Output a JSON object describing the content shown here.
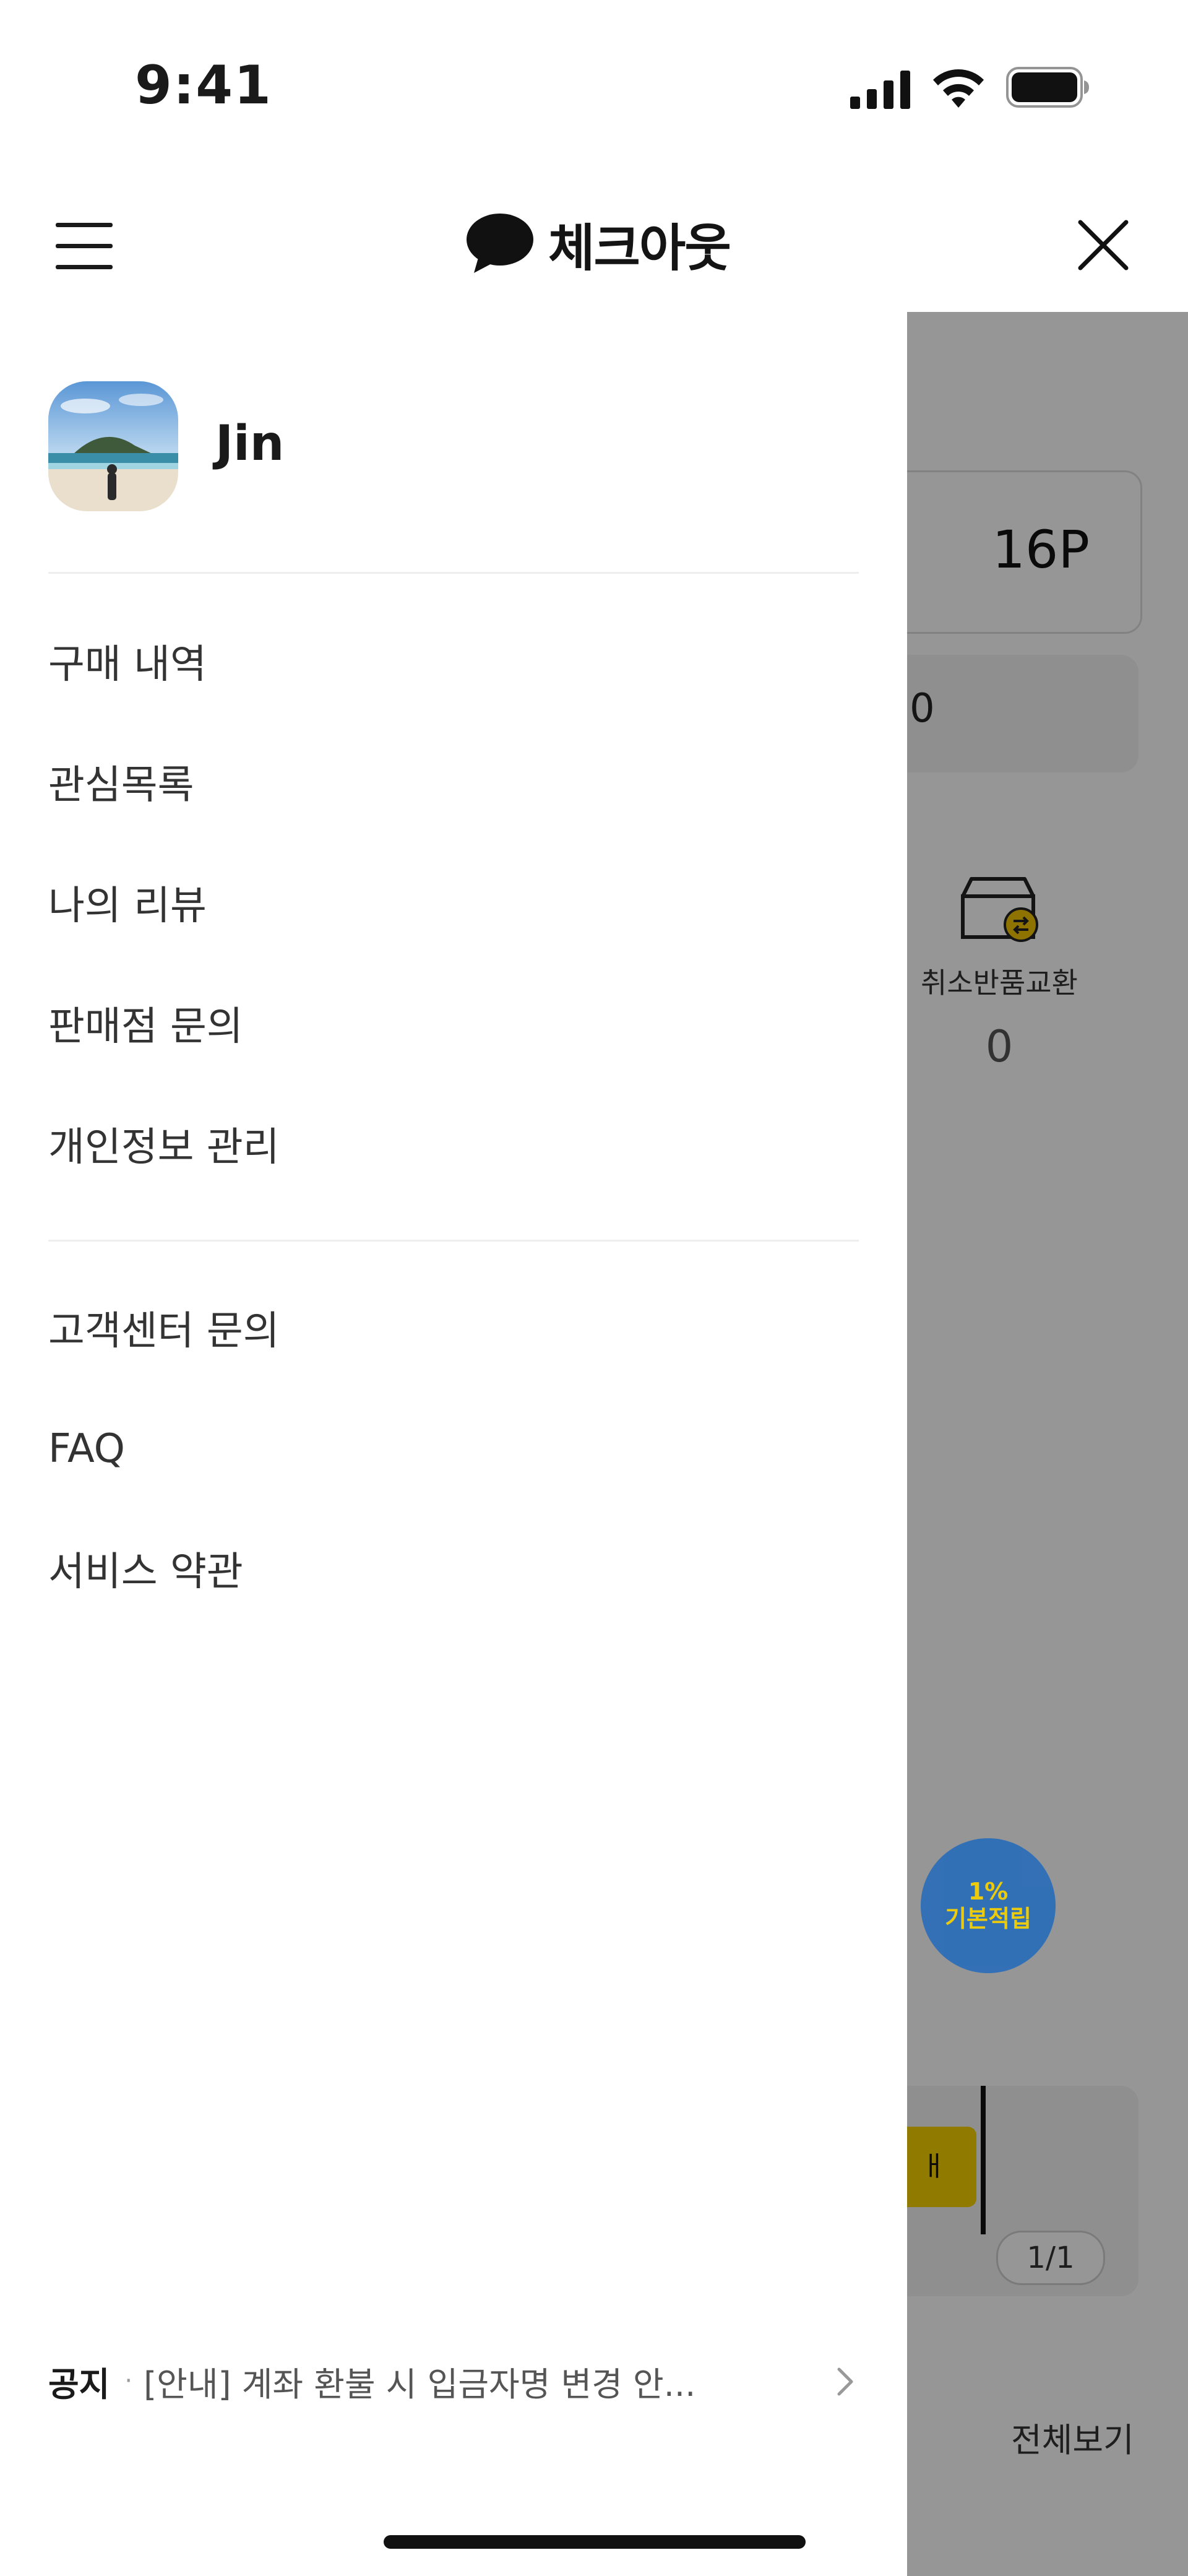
{
  "status_bar": {
    "time": "9:41"
  },
  "header": {
    "title": "체크아웃"
  },
  "drawer": {
    "profile": {
      "name": "Jin"
    },
    "menu_group_1": [
      {
        "label": "구매 내역"
      },
      {
        "label": "관심목록"
      },
      {
        "label": "나의 리뷰"
      },
      {
        "label": "판매점 문의"
      },
      {
        "label": "개인정보 관리"
      }
    ],
    "menu_group_2": [
      {
        "label": "고객센터 문의"
      },
      {
        "label": "FAQ"
      },
      {
        "label": "서비스 약관"
      }
    ],
    "notice": {
      "label": "공지",
      "separator": "·",
      "text": "[안내] 계좌 환불 시 입금자명 변경 안..."
    }
  },
  "background_page": {
    "points": "16P",
    "coupon_count": "0",
    "status": {
      "label": "취소반품교환",
      "count": "0"
    },
    "banner": {
      "tag": "ㅐ",
      "page": "1/1"
    },
    "reward_fab": {
      "line1": "1%",
      "line2": "기본적립"
    },
    "view_all": "전체보기"
  },
  "colors": {
    "overlay": "rgba(0,0,0,0.41)",
    "fab": "#1f6fc9",
    "fab_text": "#f3d000",
    "banner_tag": "#f5d000"
  }
}
